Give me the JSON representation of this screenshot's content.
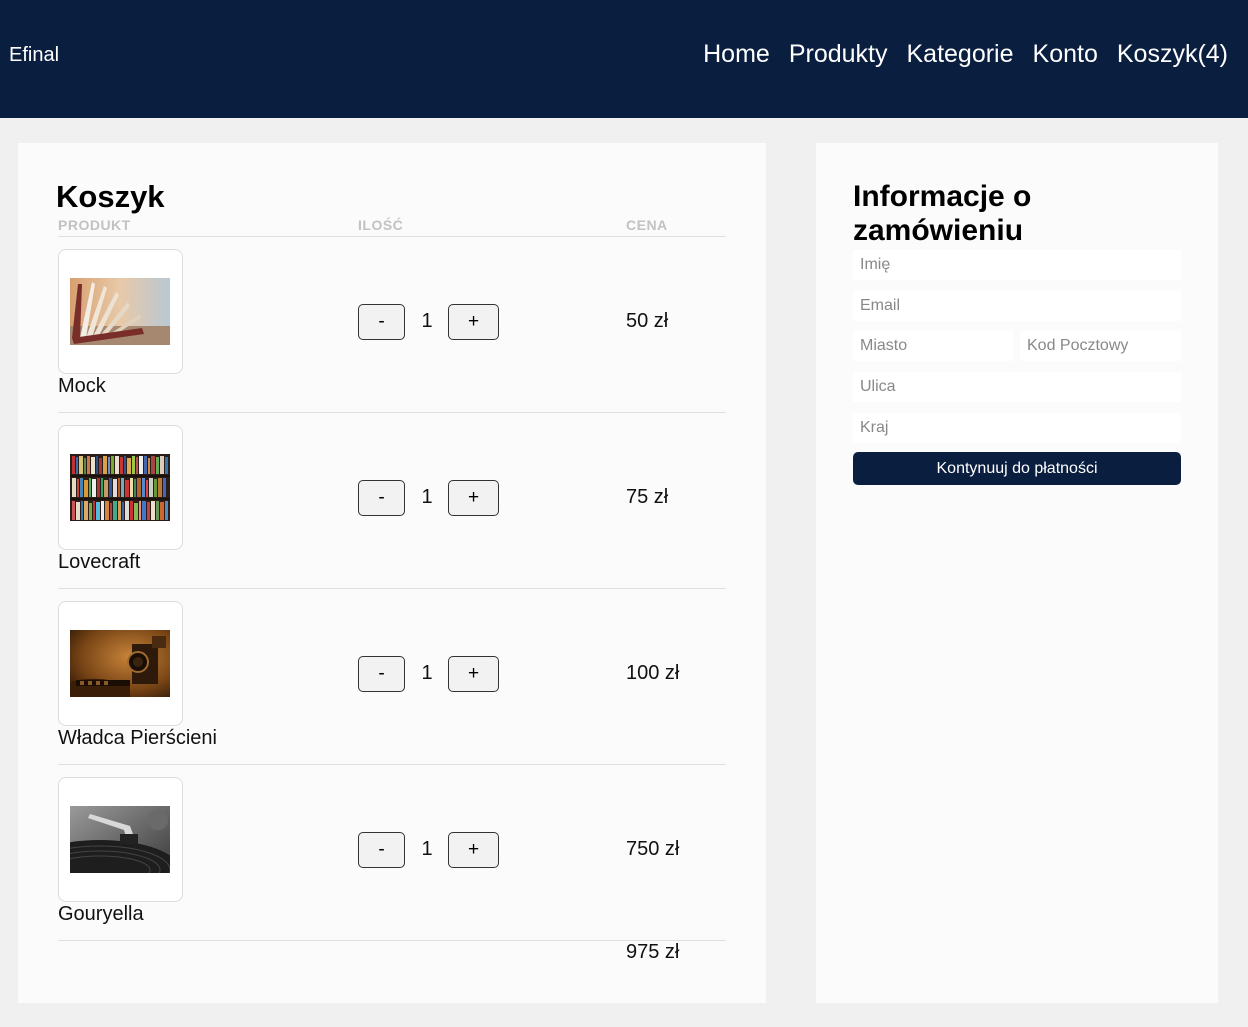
{
  "header": {
    "logo": "Efinal",
    "nav": [
      "Home",
      "Produkty",
      "Kategorie",
      "Konto",
      "Koszyk(4)"
    ]
  },
  "cart": {
    "title": "Koszyk",
    "columns": {
      "product": "PRODUKT",
      "quantity": "ILOŚĆ",
      "price": "CENA"
    },
    "items": [
      {
        "name": "Mock",
        "qty": "1",
        "price": "50 zł",
        "minus": "-",
        "plus": "+",
        "image": "open-book-photo"
      },
      {
        "name": "Lovecraft",
        "qty": "1",
        "price": "75 zł",
        "minus": "-",
        "plus": "+",
        "image": "bookshelf-photo"
      },
      {
        "name": "Władca Pierścieni",
        "qty": "1",
        "price": "100 zł",
        "minus": "-",
        "plus": "+",
        "image": "vintage-camera-photo"
      },
      {
        "name": "Gouryella",
        "qty": "1",
        "price": "750 zł",
        "minus": "-",
        "plus": "+",
        "image": "turntable-photo"
      }
    ],
    "total": "975 zł"
  },
  "order": {
    "title": "Informacje o zamówieniu",
    "fields": {
      "name": "Imię",
      "email": "Email",
      "city": "Miasto",
      "postal": "Kod Pocztowy",
      "street": "Ulica",
      "country": "Kraj"
    },
    "submit": "Kontynuuj do płatności"
  },
  "colors": {
    "header": "#0a1e3f",
    "panel": "#fbfbfb",
    "background": "#f0f0f0"
  }
}
